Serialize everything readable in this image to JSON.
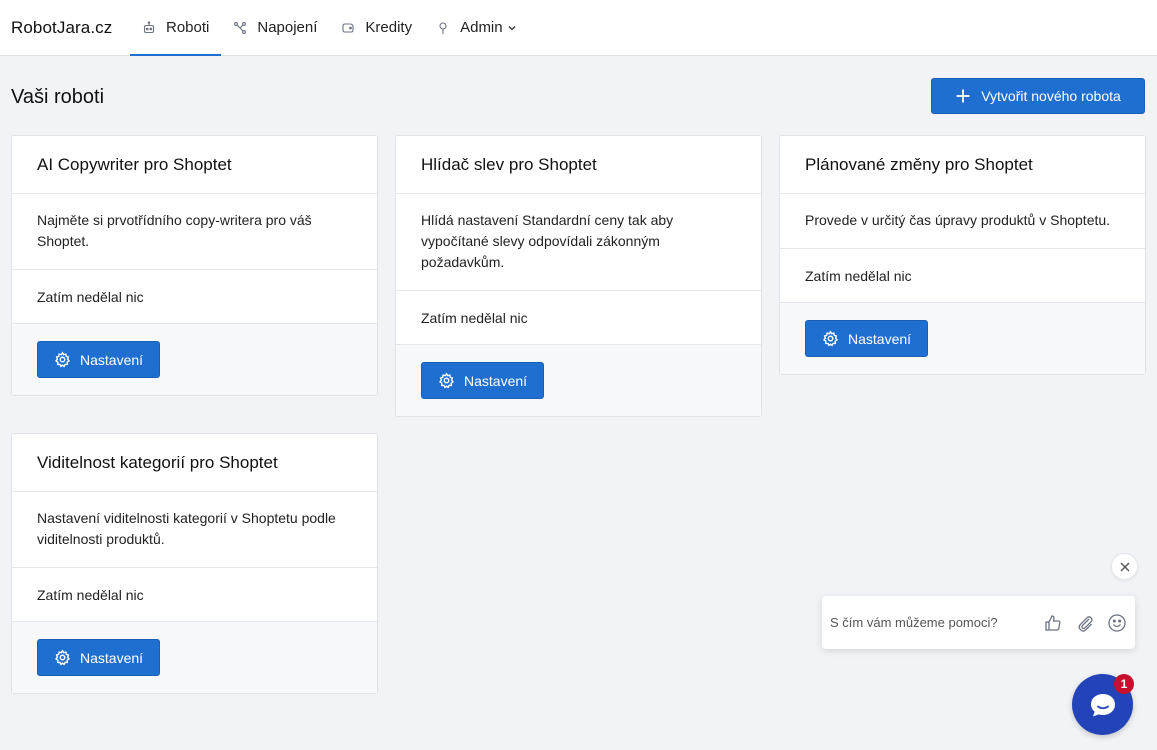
{
  "brand": "RobotJara.cz",
  "nav": [
    {
      "label": "Roboti",
      "icon": "robot-icon",
      "active": true
    },
    {
      "label": "Napojení",
      "icon": "connection-icon",
      "active": false
    },
    {
      "label": "Kredity",
      "icon": "credits-icon",
      "active": false
    },
    {
      "label": "Admin",
      "icon": "admin-icon",
      "active": false,
      "dropdown": true
    }
  ],
  "page": {
    "title": "Vaši roboti",
    "create_button": "Vytvořit nového robota"
  },
  "colors": {
    "primary": "#1f6fd1",
    "background": "#f1f3f6",
    "chat_launcher": "#2343b8",
    "badge": "#c8102e"
  },
  "robots": [
    {
      "title": "AI Copywriter pro Shoptet",
      "description": "Najměte si prvotřídního copy-writera pro váš Shoptet.",
      "status": "Zatím nedělal nic",
      "button": "Nastavení"
    },
    {
      "title": "Hlídač slev pro Shoptet",
      "description": "Hlídá nastavení Standardní ceny tak aby vypočítané slevy odpovídali zákonným požadavkům.",
      "status": "Zatím nedělal nic",
      "button": "Nastavení"
    },
    {
      "title": "Plánované změny pro Shoptet",
      "description": "Provede v určitý čas úpravy produktů v Shoptetu.",
      "status": "Zatím nedělal nic",
      "button": "Nastavení"
    },
    {
      "title": "Viditelnost kategorií pro Shoptet",
      "description": "Nastavení viditelnosti kategorií v Shoptetu podle viditelnosti produktů.",
      "status": "Zatím nedělal nic",
      "button": "Nastavení"
    }
  ],
  "chat": {
    "placeholder": "S čím vám můžeme pomoci?",
    "badge_count": "1"
  }
}
